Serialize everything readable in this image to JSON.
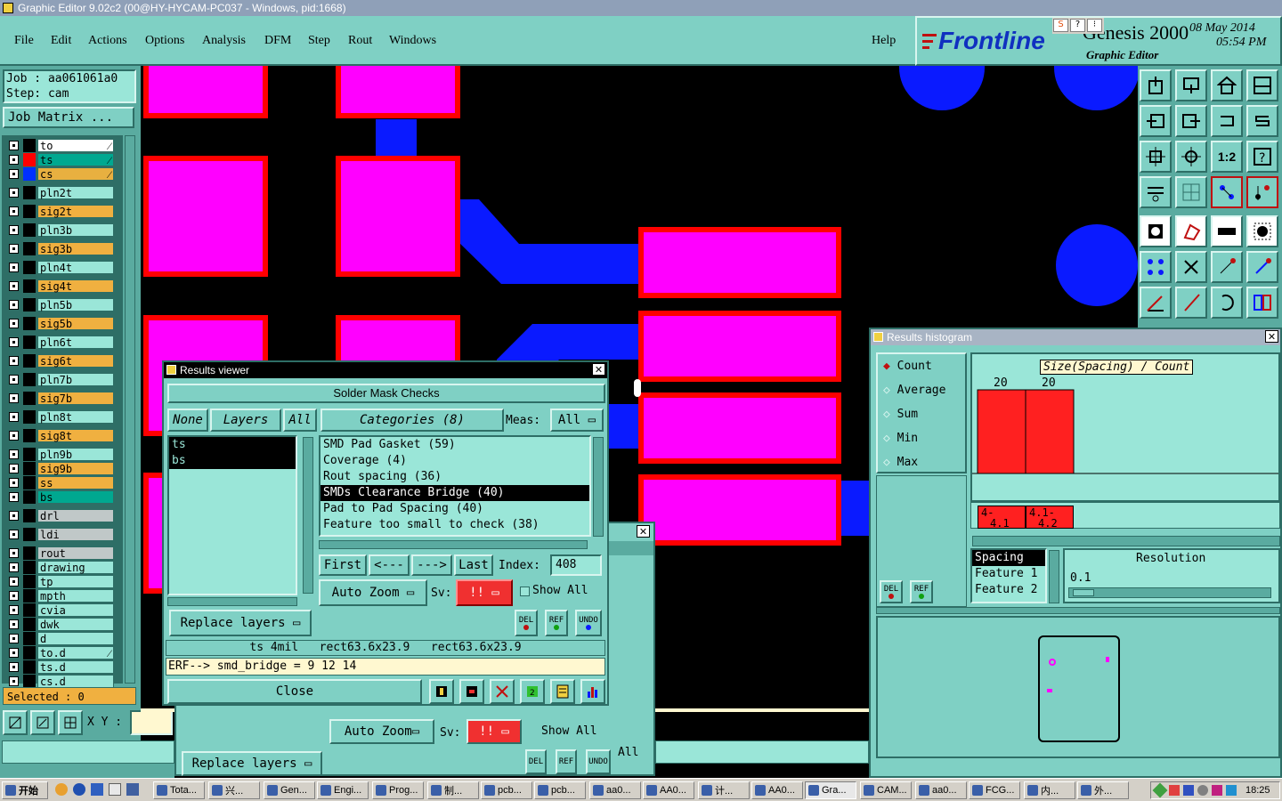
{
  "window_title": "Graphic Editor 9.02c2 (00@HY-HYCAM-PC037 - Windows, pid:1668)",
  "menu": [
    "File",
    "Edit",
    "Actions",
    "Options",
    "Analysis",
    "DFM",
    "Step",
    "Rout",
    "Windows",
    "Help"
  ],
  "brand": {
    "logo": "Frontline",
    "product": "Genesis 2000",
    "subtitle": "Graphic Editor",
    "date": "08 May 2014",
    "time": "05:54 PM"
  },
  "job": {
    "job_label": "Job : aa061061a0",
    "step_label": "Step: cam",
    "matrix_button": "Job Matrix ..."
  },
  "layers": [
    {
      "name": "to",
      "color": "#000000",
      "fill": "#ffffff",
      "mark": "⁄"
    },
    {
      "name": "ts",
      "color": "#ff0000",
      "fill": "#00a890",
      "mark": "⁄"
    },
    {
      "name": "cs",
      "color": "#0030ff",
      "fill": "#e8b040",
      "mark": "⁄"
    },
    {
      "name": "pln2t",
      "color": "#000000",
      "fill": "#9ae6d8"
    },
    {
      "name": "sig2t",
      "color": "#000000",
      "fill": "#f0b040"
    },
    {
      "name": "pln3b",
      "color": "#000000",
      "fill": "#9ae6d8"
    },
    {
      "name": "sig3b",
      "color": "#000000",
      "fill": "#f0b040"
    },
    {
      "name": "pln4t",
      "color": "#000000",
      "fill": "#9ae6d8"
    },
    {
      "name": "sig4t",
      "color": "#000000",
      "fill": "#f0b040"
    },
    {
      "name": "pln5b",
      "color": "#000000",
      "fill": "#9ae6d8"
    },
    {
      "name": "sig5b",
      "color": "#000000",
      "fill": "#f0b040"
    },
    {
      "name": "pln6t",
      "color": "#000000",
      "fill": "#9ae6d8"
    },
    {
      "name": "sig6t",
      "color": "#000000",
      "fill": "#f0b040"
    },
    {
      "name": "pln7b",
      "color": "#000000",
      "fill": "#9ae6d8"
    },
    {
      "name": "sig7b",
      "color": "#000000",
      "fill": "#f0b040"
    },
    {
      "name": "pln8t",
      "color": "#000000",
      "fill": "#9ae6d8"
    },
    {
      "name": "sig8t",
      "color": "#000000",
      "fill": "#f0b040"
    },
    {
      "name": "pln9b",
      "color": "#000000",
      "fill": "#9ae6d8"
    },
    {
      "name": "sig9b",
      "color": "#000000",
      "fill": "#f0b040"
    },
    {
      "name": "ss",
      "color": "#000000",
      "fill": "#f0b040"
    },
    {
      "name": "bs",
      "color": "#000000",
      "fill": "#00a890"
    },
    {
      "name": "drl",
      "color": "#000000",
      "fill": "#c0c8c8"
    },
    {
      "name": "ldi",
      "color": "#000000",
      "fill": "#c0c8c8"
    },
    {
      "name": "rout",
      "color": "#000000",
      "fill": "#c0c8c8"
    },
    {
      "name": "drawing",
      "color": "#000000",
      "fill": "#9ae6d8"
    },
    {
      "name": "tp",
      "color": "#000000",
      "fill": "#9ae6d8"
    },
    {
      "name": "mpth",
      "color": "#000000",
      "fill": "#9ae6d8"
    },
    {
      "name": "cvia",
      "color": "#000000",
      "fill": "#9ae6d8"
    },
    {
      "name": "dwk",
      "color": "#000000",
      "fill": "#9ae6d8"
    },
    {
      "name": "d",
      "color": "#000000",
      "fill": "#9ae6d8"
    },
    {
      "name": "to.d",
      "color": "#000000",
      "fill": "#9ae6d8",
      "mark": "⁄"
    },
    {
      "name": "ts.d",
      "color": "#000000",
      "fill": "#9ae6d8"
    },
    {
      "name": "cs.d",
      "color": "#000000",
      "fill": "#9ae6d8"
    }
  ],
  "selected_label": "Selected : 0",
  "xy_label": "X Y :",
  "results_viewer": {
    "title": "Results viewer",
    "header": "Solder Mask Checks",
    "none_btn": "None",
    "layers_btn": "Layers",
    "all_btn": "All",
    "categories_btn": "Categories (8)",
    "meas_label": "Meas:",
    "meas_value": "All",
    "layer_list": [
      "ts",
      "bs"
    ],
    "categories": [
      "SMD Pad Gasket (59)",
      "Coverage (4)",
      "Rout spacing (36)",
      "SMDs Clearance Bridge (40)",
      "Pad to Pad Spacing (40)",
      "Feature too small to check (38)"
    ],
    "selected_category": 3,
    "first_btn": "First",
    "prev_btn": "<---",
    "next_btn": "--->",
    "last_btn": "Last",
    "index_label": "Index:",
    "index_value": "408",
    "auto_zoom": "Auto Zoom",
    "sv_label": "Sv:",
    "sv_value": "!!",
    "show_all": "Show All",
    "replace_layers": "Replace layers",
    "del": "DEL",
    "ref": "REF",
    "undo": "UNDO",
    "status_line": "ts 4mil   rect63.6x23.9   rect63.6x23.9",
    "erf_line": "ERF--> smd_bridge = 9 12 14",
    "close_btn": "Close"
  },
  "back_window": {
    "auto_zoom": "Auto Zoom",
    "sv_label": "Sv:",
    "sv_value": "!!",
    "show_all": "Show All",
    "replace_layers": "Replace layers",
    "all_label": "All",
    "del": "DEL",
    "ref": "REF",
    "undo": "UNDO"
  },
  "histogram": {
    "title": "Results histogram",
    "options": [
      "Count",
      "Average",
      "Sum",
      "Min",
      "Max"
    ],
    "selected_option": 0,
    "axis_title": "Size(Spacing) / Count",
    "chart_data": {
      "type": "bar",
      "title": "Size(Spacing) / Count",
      "categories": [
        "4-4.1",
        "4.1-4.2"
      ],
      "values": [
        20,
        20
      ],
      "xlabel": "",
      "ylabel": "",
      "ylim": [
        0,
        20
      ]
    },
    "bin_labels": [
      [
        "4-",
        "4.1"
      ],
      [
        "4.1-",
        "4.2"
      ]
    ],
    "value_labels": [
      "20",
      "20"
    ],
    "list": [
      "Spacing",
      "Feature 1",
      "Feature 2"
    ],
    "resolution_label": "Resolution",
    "resolution_value": "0.1",
    "del": "DEL",
    "ref": "REF"
  },
  "taskbar": {
    "start": "开始",
    "tasks": [
      "Tota...",
      "兴...",
      "Gen...",
      "Engi...",
      "Prog...",
      "制...",
      "pcb...",
      "pcb...",
      "aa0...",
      "AA0...",
      "计...",
      "AA0...",
      "Gra...",
      "CAM...",
      "aa0...",
      "FCG...",
      "内...",
      "外..."
    ],
    "clock": "18:25"
  },
  "colors": {
    "ui": "#7fd0c4",
    "pad": "#ff00ff",
    "outline": "#ff0000",
    "trace": "#0a1aff",
    "bar": "#ff2020"
  }
}
